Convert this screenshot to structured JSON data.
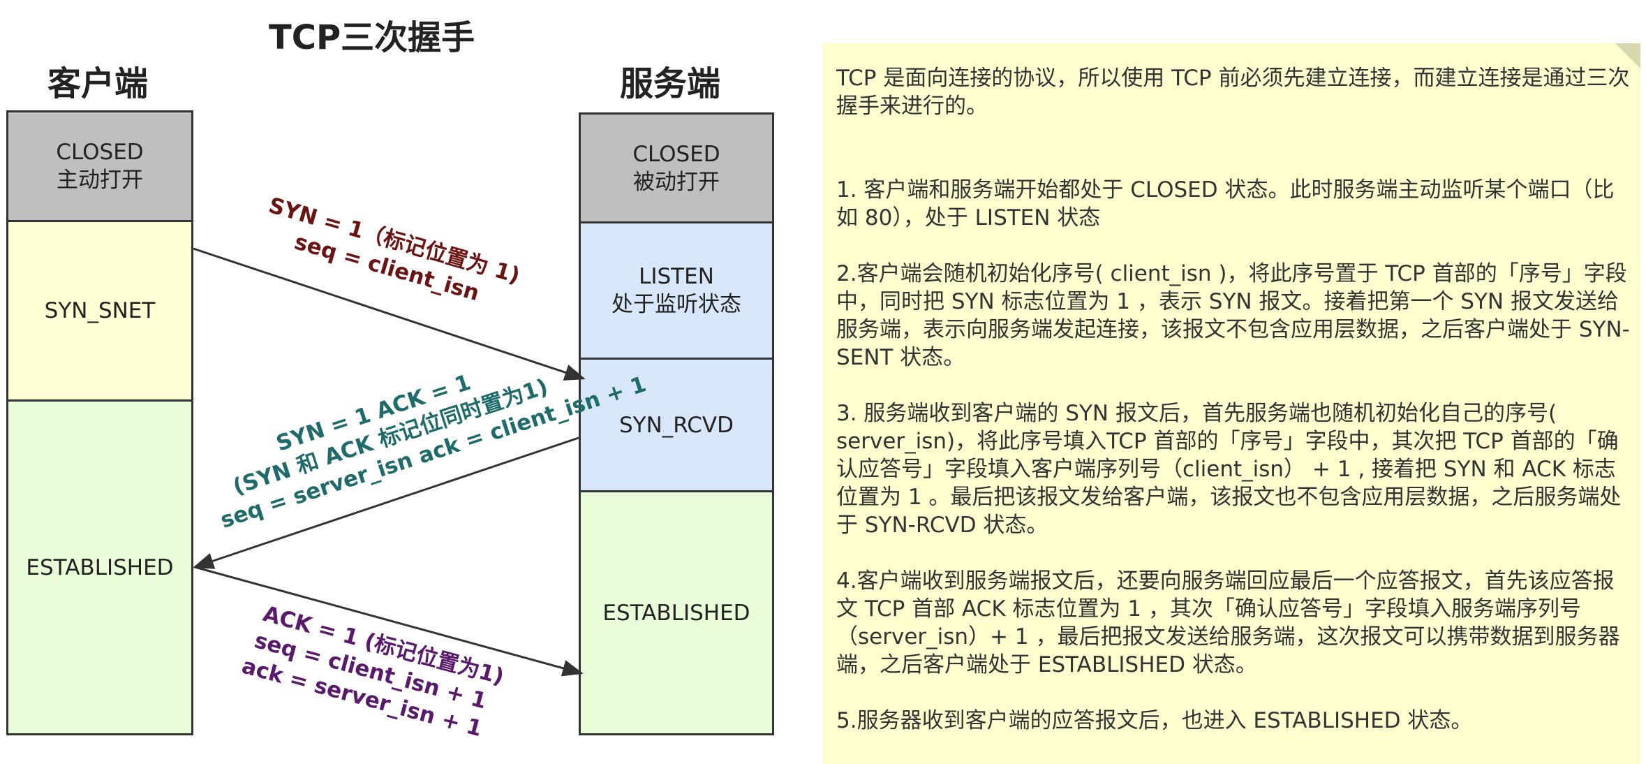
{
  "title": "TCP三次握手",
  "client": {
    "header": "客户端",
    "states": [
      {
        "lines": [
          "CLOSED",
          "主动打开"
        ]
      },
      {
        "lines": [
          "SYN_SNET"
        ]
      },
      {
        "lines": [
          "ESTABLISHED"
        ]
      }
    ]
  },
  "server": {
    "header": "服务端",
    "states": [
      {
        "lines": [
          "CLOSED",
          "被动打开"
        ]
      },
      {
        "lines": [
          "LISTEN",
          "处于监听状态"
        ]
      },
      {
        "lines": [
          "SYN_RCVD"
        ]
      },
      {
        "lines": [
          "ESTABLISHED"
        ]
      }
    ]
  },
  "messages": [
    {
      "color": "#6b1414",
      "lines": [
        "SYN =  1（标记位置为 1)",
        "seq =  client_isn"
      ]
    },
    {
      "color": "#1f6b6b",
      "lines": [
        "SYN = 1  ACK = 1",
        "(SYN 和 ACK 标记位同时置为1)",
        "seq = server_isn ack = client_isn + 1"
      ]
    },
    {
      "color": "#5a1a6b",
      "lines": [
        "ACK = 1 (标记位置为1)",
        "seq = client_isn + 1",
        "ack = server_isn + 1"
      ]
    }
  ],
  "notes": [
    "TCP 是面向连接的协议，所以使用 TCP 前必须先建立连接，而建立连接是通过三次握手来进行的。",
    "1. 客户端和服务端开始都处于 CLOSED 状态。此时服务端主动监听某个端口（比如 80），处于 LISTEN 状态",
    "2.客户端会随机初始化序号( client_isn )，将此序号置于 TCP 首部的「序号」字段中，同时把 SYN 标志位置为 1 ，表示 SYN 报文。接着把第一个 SYN 报文发送给服务端，表示向服务端发起连接，该报文不包含应用层数据，之后客户端处于 SYN-SENT 状态。",
    "3. 服务端收到客户端的 SYN 报文后，首先服务端也随机初始化自己的序号( server_isn)，将此序号填入TCP 首部的「序号」字段中，其次把 TCP 首部的「确认应答号」字段填入客户端序列号（client_isn） + 1 , 接着把 SYN 和 ACK 标志位置为 1 。最后把该报文发给客户端，该报文也不包含应用层数据，之后服务端处于 SYN-RCVD 状态。",
    "4.客户端收到服务端报文后，还要向服务端回应最后一个应答报文，首先该应答报文 TCP 首部 ACK 标志位置为 1 ，其次「确认应答号」字段填入服务端序列号（server_isn）+ 1 ，最后把报文发送给服务端，这次报文可以携带数据到服务器端，之后客户端处于 ESTABLISHED 状态。",
    "5.服务器收到客户端的应答报文后，也进入 ESTABLISHED 状态。"
  ]
}
